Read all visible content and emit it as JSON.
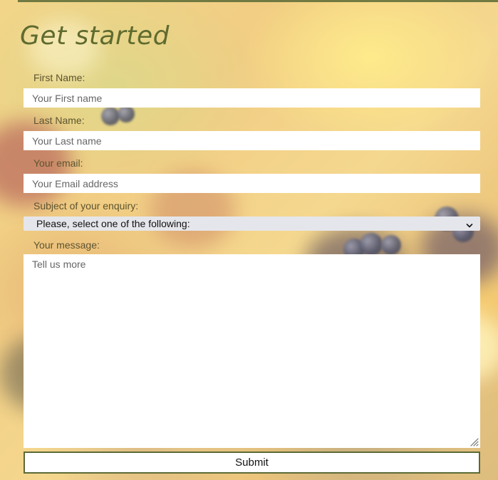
{
  "form": {
    "title": "Get started",
    "fields": {
      "first_name": {
        "label": "First Name:",
        "placeholder": "Your First name"
      },
      "last_name": {
        "label": "Last Name:",
        "placeholder": "Your Last name"
      },
      "email": {
        "label": "Your email:",
        "placeholder": "Your Email address"
      },
      "subject": {
        "label": "Subject of your enquiry:",
        "selected": "Please, select one of the following:"
      },
      "message": {
        "label": "Your message:",
        "placeholder": "Tell us more"
      }
    },
    "submit_label": "Submit"
  },
  "colors": {
    "accent": "#5b6a36",
    "title": "#5f6b2f"
  },
  "icons": {
    "select_chevron": "chevron-down-icon",
    "resize_handle": "resize-handle-icon"
  }
}
